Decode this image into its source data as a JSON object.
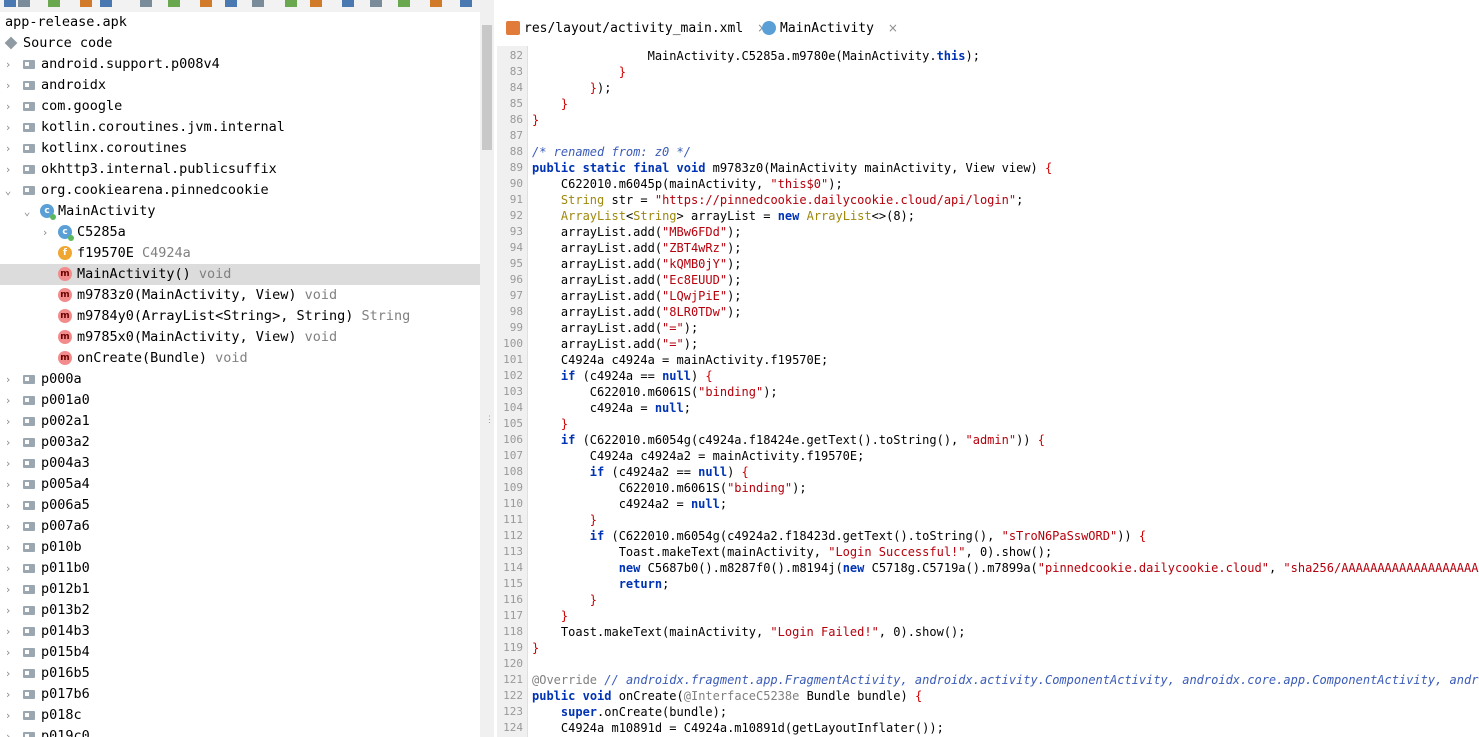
{
  "toolbar": {
    "icons": [
      "open-icon",
      "add-file-icon",
      "sync-icon",
      "save-icon",
      "save-all-icon",
      "export-icon",
      "layout-icon",
      "search-icon",
      "search-class-icon",
      "search-usage-icon",
      "back-icon",
      "forward-icon",
      "deobf-icon",
      "decompile-icon",
      "gear-icon",
      "log-icon",
      "quick-icon"
    ]
  },
  "tree": {
    "root": "app-release.apk",
    "source_code": "Source code",
    "packages_top": [
      "android.support.p008v4",
      "androidx",
      "com.google",
      "kotlin.coroutines.jvm.internal",
      "kotlinx.coroutines",
      "okhttp3.internal.publicsuffix",
      "org.cookiearena.pinnedcookie"
    ],
    "main_activity": "MainActivity",
    "members": [
      {
        "name": "C5285a",
        "type": "",
        "kind": "c"
      },
      {
        "name": "f19570E",
        "type": "C4924a",
        "kind": "f"
      },
      {
        "name": "MainActivity()",
        "type": "void",
        "kind": "m"
      },
      {
        "name": "m9783z0(MainActivity, View)",
        "type": "void",
        "kind": "m"
      },
      {
        "name": "m9784y0(ArrayList<String>, String)",
        "type": "String",
        "kind": "m"
      },
      {
        "name": "m9785x0(MainActivity, View)",
        "type": "void",
        "kind": "m"
      },
      {
        "name": "onCreate(Bundle)",
        "type": "void",
        "kind": "m"
      }
    ],
    "packages_bottom": [
      "p000a",
      "p001a0",
      "p002a1",
      "p003a2",
      "p004a3",
      "p005a4",
      "p006a5",
      "p007a6",
      "p010b",
      "p011b0",
      "p012b1",
      "p013b2",
      "p014b3",
      "p015b4",
      "p016b5",
      "p017b6",
      "p018c",
      "p019c0"
    ]
  },
  "tabs": [
    {
      "label": "res/layout/activity_main.xml",
      "close": "×"
    },
    {
      "label": "MainActivity",
      "close": "×"
    }
  ],
  "editor": {
    "lines": [
      {
        "n": "82",
        "t": "                MainActivity.C5285a.m9780e(MainActivity.this);"
      },
      {
        "n": "83",
        "t": "            }"
      },
      {
        "n": "84",
        "t": "        });"
      },
      {
        "n": "85",
        "t": "    }"
      },
      {
        "n": "86",
        "t": "}"
      },
      {
        "n": "87",
        "t": ""
      },
      {
        "n": "88",
        "t": "/* renamed from: z0 */"
      },
      {
        "n": "89",
        "t": "public static final void m9783z0(MainActivity mainActivity, View view) {"
      },
      {
        "n": "90",
        "t": "    C622010.m6045p(mainActivity, \"this$0\");"
      },
      {
        "n": "91",
        "t": "    String str = \"https://pinnedcookie.dailycookie.cloud/api/login\";"
      },
      {
        "n": "92",
        "t": "    ArrayList<String> arrayList = new ArrayList<>(8);"
      },
      {
        "n": "93",
        "t": "    arrayList.add(\"MBw6FDd\");"
      },
      {
        "n": "94",
        "t": "    arrayList.add(\"ZBT4wRz\");"
      },
      {
        "n": "95",
        "t": "    arrayList.add(\"kQMB0jY\");"
      },
      {
        "n": "96",
        "t": "    arrayList.add(\"Ec8EUUD\");"
      },
      {
        "n": "97",
        "t": "    arrayList.add(\"LQwjPiE\");"
      },
      {
        "n": "98",
        "t": "    arrayList.add(\"8LR0TDw\");"
      },
      {
        "n": "99",
        "t": "    arrayList.add(\"=\");"
      },
      {
        "n": "100",
        "t": "    arrayList.add(\"=\");"
      },
      {
        "n": "101",
        "t": "    C4924a c4924a = mainActivity.f19570E;"
      },
      {
        "n": "102",
        "t": "    if (c4924a == null) {"
      },
      {
        "n": "103",
        "t": "        C622010.m6061S(\"binding\");"
      },
      {
        "n": "104",
        "t": "        c4924a = null;"
      },
      {
        "n": "105",
        "t": "    }"
      },
      {
        "n": "106",
        "t": "    if (C622010.m6054g(c4924a.f18424e.getText().toString(), \"admin\")) {"
      },
      {
        "n": "107",
        "t": "        C4924a c4924a2 = mainActivity.f19570E;"
      },
      {
        "n": "108",
        "t": "        if (c4924a2 == null) {"
      },
      {
        "n": "109",
        "t": "            C622010.m6061S(\"binding\");"
      },
      {
        "n": "110",
        "t": "            c4924a2 = null;"
      },
      {
        "n": "111",
        "t": "        }"
      },
      {
        "n": "112",
        "t": "        if (C622010.m6054g(c4924a2.f18423d.getText().toString(), \"sTroN6PaSswORD\")) {"
      },
      {
        "n": "113",
        "t": "            Toast.makeText(mainActivity, \"Login Successful!\", 0).show();"
      },
      {
        "n": "114",
        "t": "            new C5687b0().m8287f0().m8194j(new C5718g.C5719a().m7899a(\"pinnedcookie.dailycookie.cloud\", \"sha256/AAAAAAAAAAAAAAAAAAAAAAA"
      },
      {
        "n": "115",
        "t": "            return;"
      },
      {
        "n": "116",
        "t": "        }"
      },
      {
        "n": "117",
        "t": "    }"
      },
      {
        "n": "118",
        "t": "    Toast.makeText(mainActivity, \"Login Failed!\", 0).show();"
      },
      {
        "n": "119",
        "t": "}"
      },
      {
        "n": "120",
        "t": ""
      },
      {
        "n": "121",
        "t": "@Override // androidx.fragment.app.FragmentActivity, androidx.activity.ComponentActivity, androidx.core.app.ComponentActivity, andro"
      },
      {
        "n": "122",
        "t": "public void onCreate(@InterfaceC5238e Bundle bundle) {"
      },
      {
        "n": "123",
        "t": "    super.onCreate(bundle);"
      },
      {
        "n": "124",
        "t": "    C4924a m10891d = C4924a.m10891d(getLayoutInflater());"
      }
    ]
  }
}
